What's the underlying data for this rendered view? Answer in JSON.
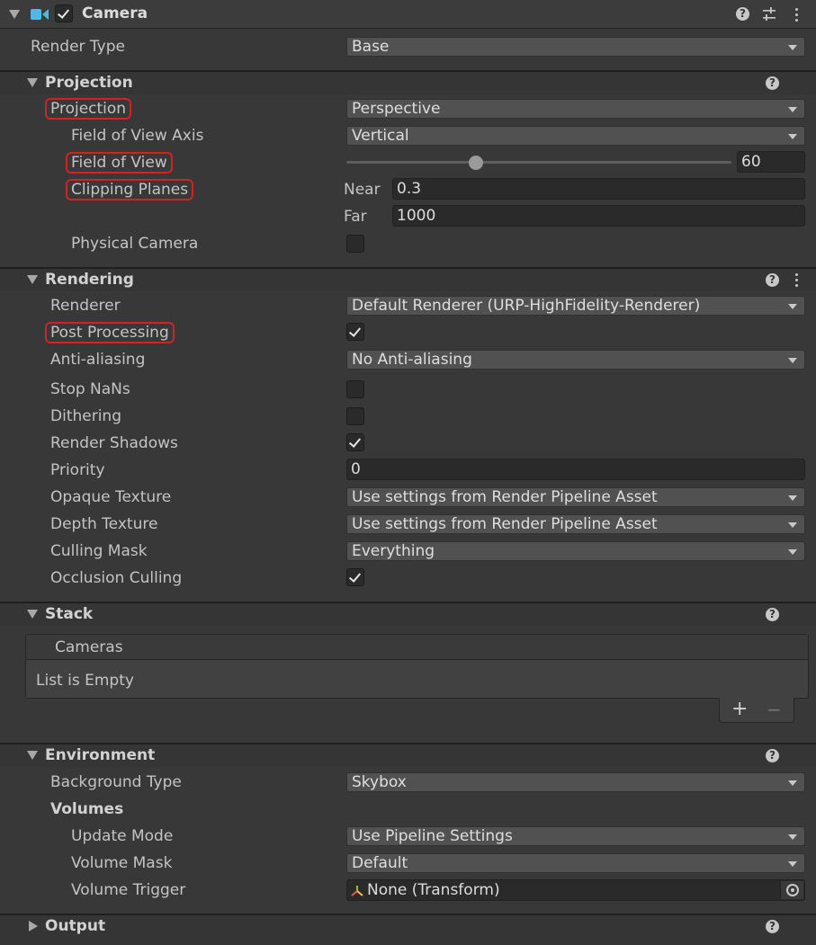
{
  "header": {
    "title": "Camera",
    "enabled": true
  },
  "render_type": {
    "label": "Render Type",
    "value": "Base"
  },
  "projection_section": {
    "title": "Projection",
    "projection": {
      "label": "Projection",
      "value": "Perspective"
    },
    "fov_axis": {
      "label": "Field of View Axis",
      "value": "Vertical"
    },
    "fov": {
      "label": "Field of View",
      "value": "60"
    },
    "clipping": {
      "label": "Clipping Planes",
      "near_label": "Near",
      "near_value": "0.3",
      "far_label": "Far",
      "far_value": "1000"
    },
    "physical": {
      "label": "Physical Camera",
      "checked": false
    }
  },
  "rendering_section": {
    "title": "Rendering",
    "renderer": {
      "label": "Renderer",
      "value": "Default Renderer (URP-HighFidelity-Renderer)"
    },
    "post_processing": {
      "label": "Post Processing",
      "checked": true
    },
    "anti_aliasing": {
      "label": "Anti-aliasing",
      "value": "No Anti-aliasing"
    },
    "stop_nans": {
      "label": "Stop NaNs",
      "checked": false
    },
    "dithering": {
      "label": "Dithering",
      "checked": false
    },
    "render_shadows": {
      "label": "Render Shadows",
      "checked": true
    },
    "priority": {
      "label": "Priority",
      "value": "0"
    },
    "opaque_texture": {
      "label": "Opaque Texture",
      "value": "Use settings from Render Pipeline Asset"
    },
    "depth_texture": {
      "label": "Depth Texture",
      "value": "Use settings from Render Pipeline Asset"
    },
    "culling_mask": {
      "label": "Culling Mask",
      "value": "Everything"
    },
    "occlusion_culling": {
      "label": "Occlusion Culling",
      "checked": true
    }
  },
  "stack_section": {
    "title": "Stack",
    "list_header": "Cameras",
    "empty_text": "List is Empty",
    "add": "+",
    "remove": "−"
  },
  "environment_section": {
    "title": "Environment",
    "background_type": {
      "label": "Background Type",
      "value": "Skybox"
    },
    "volumes_label": "Volumes",
    "update_mode": {
      "label": "Update Mode",
      "value": "Use Pipeline Settings"
    },
    "volume_mask": {
      "label": "Volume Mask",
      "value": "Default"
    },
    "volume_trigger": {
      "label": "Volume Trigger",
      "value": "None (Transform)"
    }
  },
  "output_section": {
    "title": "Output"
  },
  "help_glyph": "?",
  "colors": {
    "highlight": "#d22222",
    "camera_icon": "#4fb8e6"
  }
}
